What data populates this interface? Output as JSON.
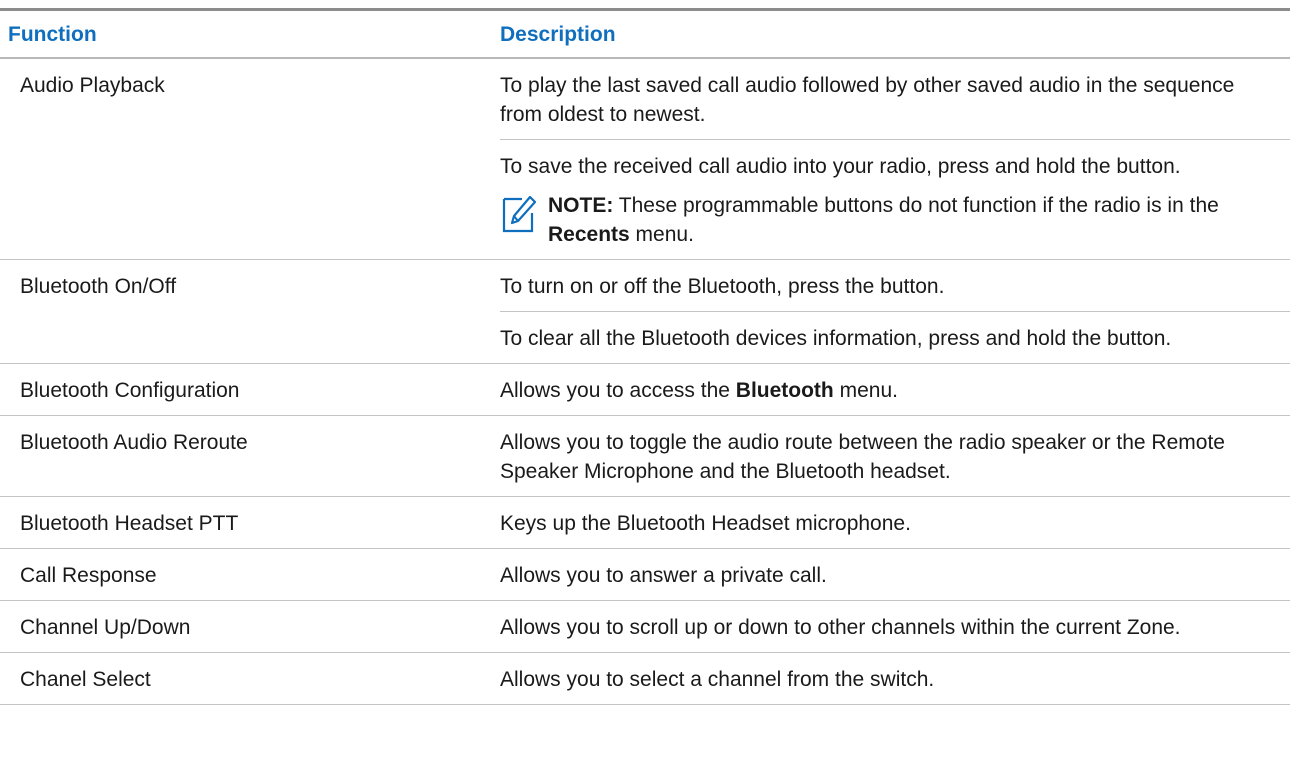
{
  "table": {
    "headers": {
      "function": "Function",
      "description": "Description"
    },
    "rows": {
      "audio_playback": {
        "function": "Audio Playback",
        "desc1": "To play the last saved call audio followed by other saved audio in the sequence from oldest to newest.",
        "desc2": "To save the received call audio into your radio, press and hold the button.",
        "note": {
          "label": "NOTE:",
          "text_before": " These programmable buttons do not function if the radio is in the ",
          "bold": "Recents",
          "text_after": " menu.",
          "icon": "note-pencil-icon"
        }
      },
      "bluetooth_onoff": {
        "function": "Bluetooth On/Off",
        "desc1": "To turn on or off the Bluetooth, press the button.",
        "desc2": "To clear all the Bluetooth devices information, press and hold the button."
      },
      "bluetooth_config": {
        "function": "Bluetooth Configuration",
        "desc_before": "Allows you to access the ",
        "desc_bold": "Bluetooth",
        "desc_after": " menu."
      },
      "bluetooth_reroute": {
        "function": "Bluetooth Audio Reroute",
        "desc": "Allows you to toggle the audio route between the radio speaker or the Remote Speaker Microphone and the Bluetooth headset."
      },
      "bluetooth_ptt": {
        "function": "Bluetooth Headset PTT",
        "desc": "Keys up the Bluetooth Headset microphone."
      },
      "call_response": {
        "function": "Call Response",
        "desc": "Allows you to answer a private call."
      },
      "channel_updown": {
        "function": "Channel Up/Down",
        "desc": "Allows you to scroll up or down to other channels within the current Zone."
      },
      "channel_select": {
        "function": "Chanel Select",
        "desc": "Allows you to select a channel from the switch."
      }
    }
  },
  "colors": {
    "header_text": "#0f6fbe",
    "rule": "#c4c4c4"
  }
}
